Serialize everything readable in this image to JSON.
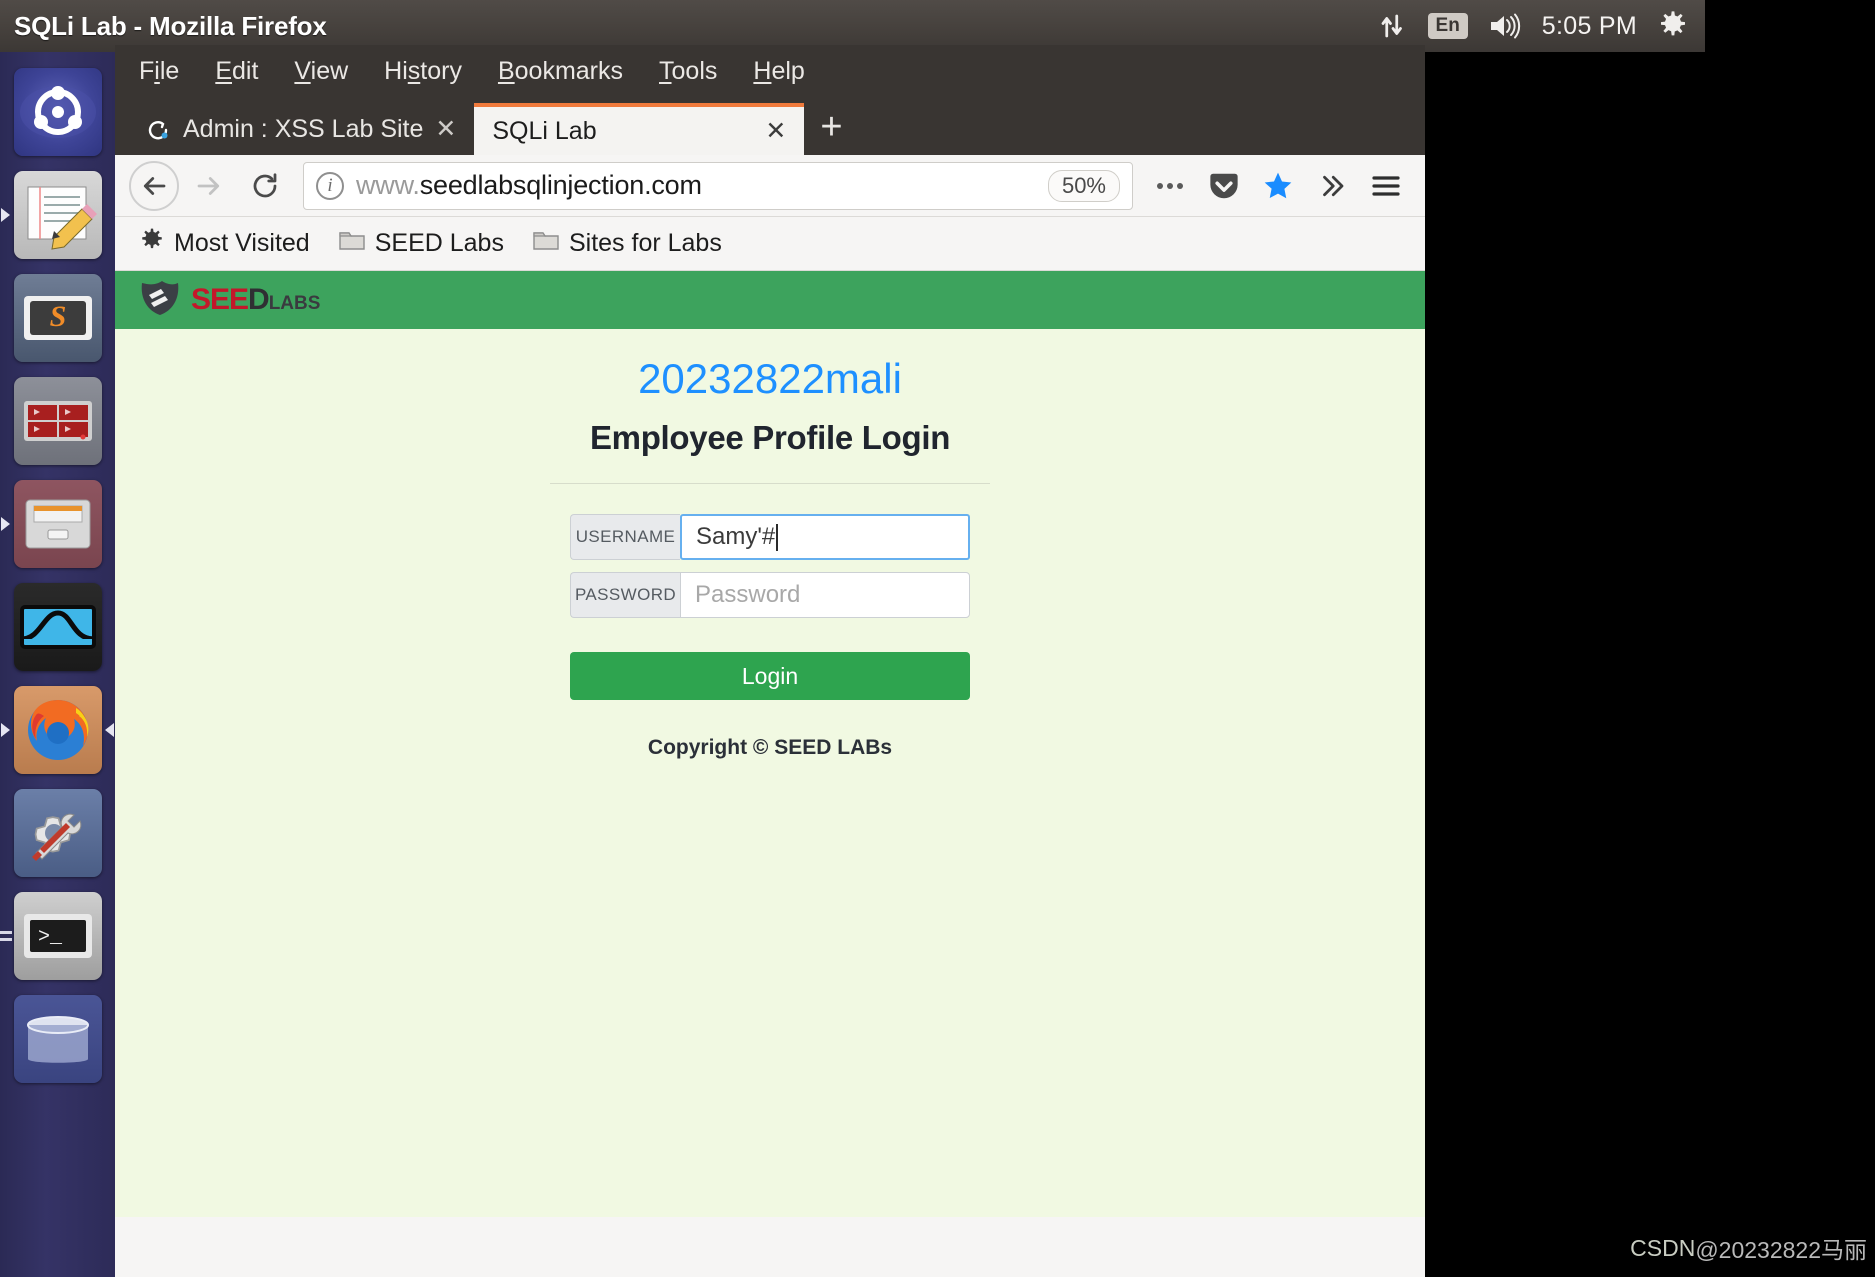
{
  "window": {
    "title": "SQLi Lab - Mozilla Firefox"
  },
  "tray": {
    "network_icon": "network-updown-icon",
    "keyboard_layout": "En",
    "volume_icon": "volume-icon",
    "clock": "5:05 PM",
    "settings_icon": "gear-icon"
  },
  "launcher": {
    "items": [
      {
        "name": "ubuntu-dash",
        "label": "Ubuntu Dash"
      },
      {
        "name": "text-editor",
        "label": "Text Editor"
      },
      {
        "name": "sublime-text",
        "label": "Sublime Text"
      },
      {
        "name": "media-grid-app",
        "label": "Media App"
      },
      {
        "name": "file-manager",
        "label": "Files"
      },
      {
        "name": "wireshark",
        "label": "Wireshark"
      },
      {
        "name": "firefox",
        "label": "Firefox"
      },
      {
        "name": "system-tools",
        "label": "System Tools"
      },
      {
        "name": "terminal",
        "label": "Terminal"
      },
      {
        "name": "trash",
        "label": "Trash"
      }
    ]
  },
  "menubar": {
    "items": [
      {
        "pre": "F",
        "key": "i",
        "post": "le"
      },
      {
        "pre": "",
        "key": "E",
        "post": "dit"
      },
      {
        "pre": "",
        "key": "V",
        "post": "iew"
      },
      {
        "pre": "Hi",
        "key": "s",
        "post": "tory"
      },
      {
        "pre": "",
        "key": "B",
        "post": "ookmarks"
      },
      {
        "pre": "",
        "key": "T",
        "post": "ools"
      },
      {
        "pre": "",
        "key": "H",
        "post": "elp"
      }
    ]
  },
  "tabs": {
    "items": [
      {
        "title": "Admin : XSS Lab Site",
        "active": false,
        "favicon": "e-favicon",
        "close": "✕"
      },
      {
        "title": "SQLi Lab",
        "active": true,
        "favicon": "",
        "close": "✕"
      }
    ],
    "new_tab_label": "+"
  },
  "navbar": {
    "back_icon": "back-arrow-icon",
    "forward_icon": "forward-arrow-icon",
    "reload_icon": "reload-icon",
    "identity_icon": "info-icon",
    "url_prefix": "www.",
    "url_domain": "seedlabsqlinjection.com",
    "zoom_level": "50%",
    "page_actions_icon": "ellipsis-icon",
    "pocket_icon": "pocket-icon",
    "bookmark_star_icon": "star-icon",
    "overflow_icon": "chevron-double-right-icon",
    "menu_icon": "hamburger-menu-icon"
  },
  "bookmarks": {
    "items": [
      {
        "label": "Most Visited",
        "icon": "gear-icon"
      },
      {
        "label": "SEED Labs",
        "icon": "folder-icon"
      },
      {
        "label": "Sites for Labs",
        "icon": "folder-icon"
      }
    ]
  },
  "site": {
    "brand": {
      "shield_icon": "seed-shield-icon",
      "seed_red": "SEE",
      "seed_dark": "D",
      "labs": "LABS"
    },
    "student_id": "20232822mali",
    "heading": "Employee Profile Login",
    "form": {
      "username_label": "USERNAME",
      "username_value": "Samy'#",
      "password_label": "PASSWORD",
      "password_placeholder": "Password",
      "login_button": "Login"
    },
    "copyright": "Copyright © SEED LABs"
  },
  "watermark": {
    "source": "CSDN",
    "user": "@20232822马丽"
  },
  "colors": {
    "accent_green": "#3da35d",
    "button_green": "#2ea44f",
    "page_bg": "#f1f9e2",
    "student_blue": "#1e90ff",
    "tab_active_accent": "#f07a3c"
  }
}
